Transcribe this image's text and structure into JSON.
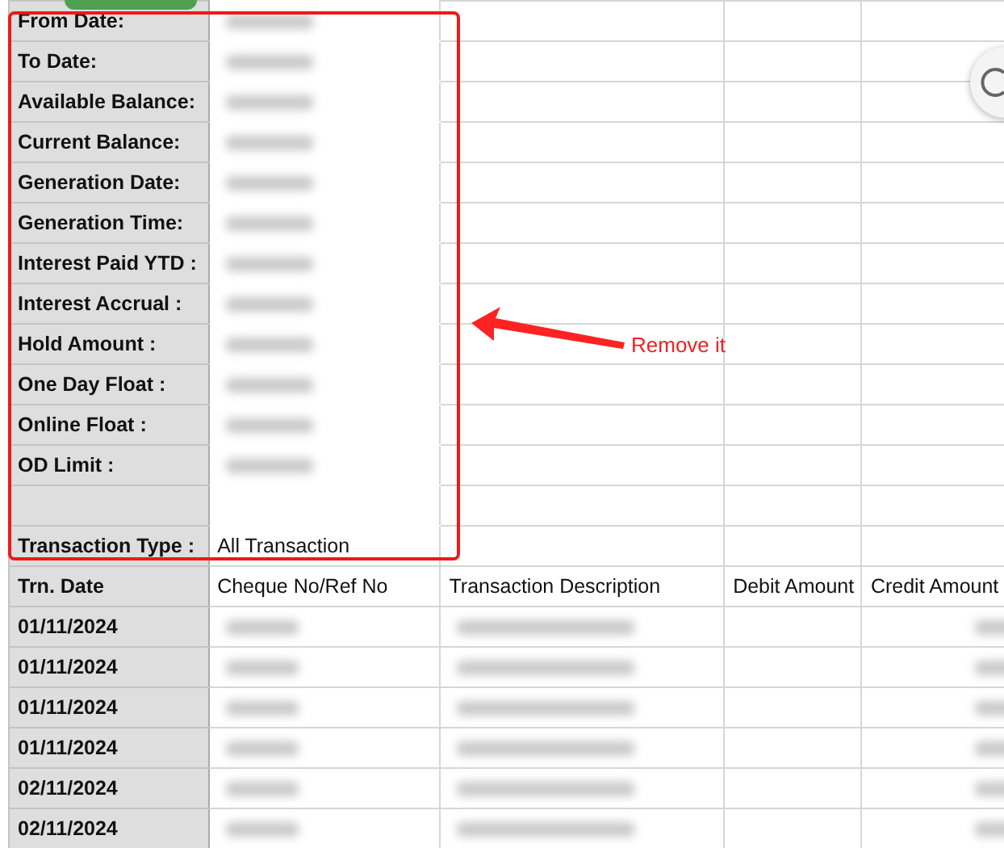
{
  "sheet_tab": {
    "selected": true
  },
  "info_rows": [
    {
      "kind": "redacted",
      "label": "From Date:"
    },
    {
      "kind": "redacted",
      "label": "To Date:"
    },
    {
      "kind": "redacted",
      "label": "Available Balance:"
    },
    {
      "kind": "redacted",
      "label": "Current Balance:"
    },
    {
      "kind": "redacted",
      "label": "Generation Date:"
    },
    {
      "kind": "redacted",
      "label": "Generation Time:"
    },
    {
      "kind": "redacted",
      "label": "Interest Paid YTD :"
    },
    {
      "kind": "redacted",
      "label": "Interest Accrual :"
    },
    {
      "kind": "redacted",
      "label": "Hold Amount :"
    },
    {
      "kind": "redacted",
      "label": "One Day Float :"
    },
    {
      "kind": "redacted",
      "label": "Online Float :"
    },
    {
      "kind": "redacted",
      "label": "OD Limit :"
    },
    {
      "kind": "blank"
    },
    {
      "kind": "text",
      "label": "Transaction Type :",
      "value": "All Transaction"
    }
  ],
  "table": {
    "columns": [
      "Trn. Date",
      "Cheque No/Ref No",
      "Transaction Description",
      "Debit Amount",
      "Credit Amount"
    ],
    "rows": [
      {
        "date": "01/11/2024",
        "cells": [
          {
            "kind": "redacted"
          },
          {
            "kind": "redacted"
          },
          {
            "kind": "empty"
          },
          {
            "kind": "redacted"
          }
        ]
      },
      {
        "date": "01/11/2024",
        "cells": [
          {
            "kind": "redacted"
          },
          {
            "kind": "redacted"
          },
          {
            "kind": "empty"
          },
          {
            "kind": "redacted"
          }
        ]
      },
      {
        "date": "01/11/2024",
        "cells": [
          {
            "kind": "redacted"
          },
          {
            "kind": "redacted"
          },
          {
            "kind": "empty"
          },
          {
            "kind": "redacted"
          }
        ]
      },
      {
        "date": "01/11/2024",
        "cells": [
          {
            "kind": "redacted"
          },
          {
            "kind": "redacted"
          },
          {
            "kind": "empty"
          },
          {
            "kind": "redacted"
          }
        ]
      },
      {
        "date": "02/11/2024",
        "cells": [
          {
            "kind": "redacted"
          },
          {
            "kind": "redacted"
          },
          {
            "kind": "empty"
          },
          {
            "kind": "redacted"
          }
        ]
      },
      {
        "date": "02/11/2024",
        "cells": [
          {
            "kind": "redacted"
          },
          {
            "kind": "redacted"
          },
          {
            "kind": "empty"
          },
          {
            "kind": "redacted"
          }
        ]
      }
    ]
  },
  "annotation": {
    "text": "Remove it"
  }
}
